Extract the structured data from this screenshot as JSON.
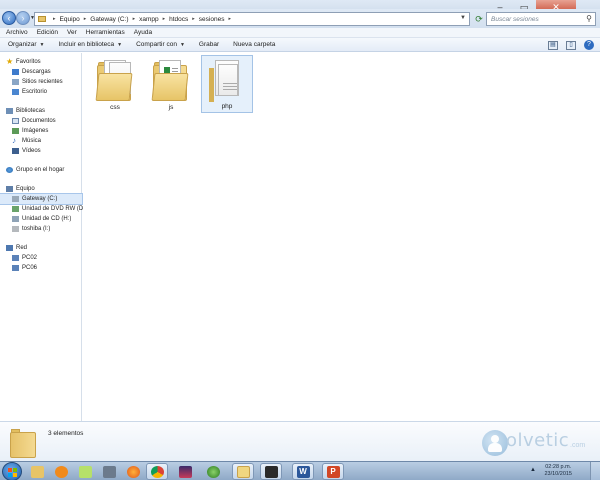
{
  "address": {
    "crumbs": [
      "Equipo",
      "Gateway (C:)",
      "xampp",
      "htdocs",
      "sesiones"
    ]
  },
  "search": {
    "placeholder": "Buscar sesiones"
  },
  "menu": [
    "Archivo",
    "Edición",
    "Ver",
    "Herramientas",
    "Ayuda"
  ],
  "toolbar": {
    "organize": "Organizar",
    "include": "Incluir en biblioteca",
    "share": "Compartir con",
    "burn": "Grabar",
    "new_folder": "Nueva carpeta"
  },
  "nav": {
    "favorites": "Favoritos",
    "downloads": "Descargas",
    "recent": "Sitios recientes",
    "desktop": "Escritorio",
    "libraries": "Bibliotecas",
    "documents": "Documentos",
    "images": "Imágenes",
    "music": "Música",
    "videos": "Vídeos",
    "homegroup": "Grupo en el hogar",
    "computer": "Equipo",
    "drive_c": "Gateway (C:)",
    "drive_d": "Unidad de DVD RW (D:)",
    "drive_h": "Unidad de CD (H:)",
    "drive_i": "toshiba (I:)",
    "network": "Red",
    "pc02": "PC02",
    "pc06": "PC06"
  },
  "items": [
    "css",
    "js",
    "php"
  ],
  "selected_item": "php",
  "details": {
    "count": "3 elementos"
  },
  "watermark": {
    "brand": "olvetic",
    "suffix": ".com"
  },
  "taskbar": {
    "time": "02:28 p.m.",
    "date": "23/10/2015",
    "apps": [
      "explorer-folder",
      "media-player",
      "sticky-notes",
      "calculator",
      "firefox",
      "chrome",
      "photo-app",
      "xampp",
      "file-explorer",
      "video-editor",
      "word",
      "powerpoint"
    ]
  },
  "colors": {
    "folder": "#e9c86f",
    "selection": "#dceafa",
    "chrome": "#dfe9f5",
    "taskbar": "#9fb6d2"
  }
}
